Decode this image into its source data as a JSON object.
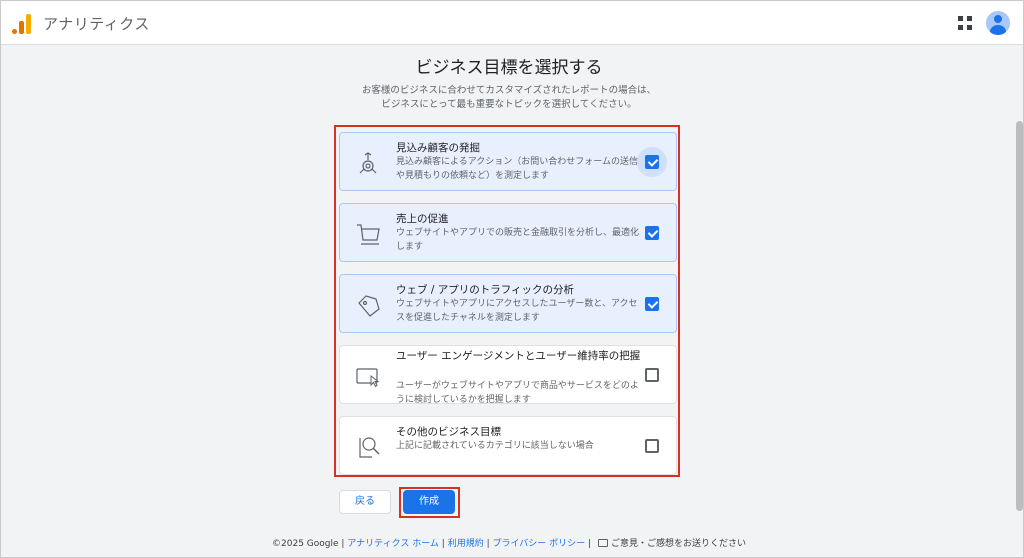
{
  "header": {
    "app_title": "アナリティクス",
    "apps_icon": "grid-apps-icon",
    "avatar_icon": "account-avatar-icon"
  },
  "main": {
    "title": "ビジネス目標を選択する",
    "description_line1": "お客様のビジネスに合わせてカスタマイズされたレポートの場合は、",
    "description_line2": "ビジネスにとって最も重要なトピックを選択してください。"
  },
  "options": [
    {
      "title": "見込み顧客の発掘",
      "description": "見込み顧客によるアクション（お問い合わせフォームの送信や見積もりの依頼など）を測定します",
      "checked": true,
      "icon": "target-lead-icon"
    },
    {
      "title": "売上の促進",
      "description": "ウェブサイトやアプリでの販売と金融取引を分析し、最適化します",
      "checked": true,
      "icon": "shopping-cart-icon"
    },
    {
      "title": "ウェブ / アプリのトラフィックの分析",
      "description": "ウェブサイトやアプリにアクセスしたユーザー数と、アクセスを促進したチャネルを測定します",
      "checked": true,
      "icon": "tag-icon"
    },
    {
      "title": "ユーザー エンゲージメントとユーザー維持率の把握",
      "description": "ユーザーがウェブサイトやアプリで商品やサービスをどのように検討しているかを把握します",
      "checked": false,
      "icon": "screen-cursor-icon"
    },
    {
      "title": "その他のビジネス目標",
      "description": "上記に記載されているカテゴリに該当しない場合",
      "checked": false,
      "icon": "magnifier-document-icon"
    }
  ],
  "buttons": {
    "back_label": "戻る",
    "create_label": "作成"
  },
  "footer": {
    "copyright": "©2025 Google",
    "link_home": "アナリティクス ホーム",
    "link_terms": "利用規約",
    "link_privacy": "プライバシー ポリシー",
    "feedback": "ご意見・ご感想をお送りください",
    "separator": " | "
  },
  "colors": {
    "accent": "#1a73e8",
    "selected_bg": "#e8f0fe",
    "highlight_frame": "#d93025"
  }
}
